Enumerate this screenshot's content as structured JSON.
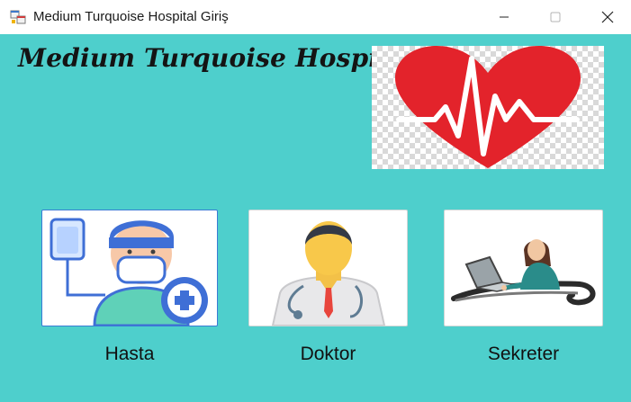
{
  "window": {
    "title": "Medium Turquoise Hospital Giriş",
    "icon": "app-window-icon",
    "controls": [
      "minimize-icon",
      "maximize-icon",
      "close-icon"
    ]
  },
  "header": {
    "brand": "Medium Turquoise Hospital",
    "hero_image": "heart-pulse-icon"
  },
  "roles": [
    {
      "label": "Hasta",
      "icon": "patient-icon"
    },
    {
      "label": "Doktor",
      "icon": "doctor-icon"
    },
    {
      "label": "Sekreter",
      "icon": "secretary-icon"
    }
  ],
  "colors": {
    "background": "#4ecfcc",
    "heart": "#e3232b"
  }
}
